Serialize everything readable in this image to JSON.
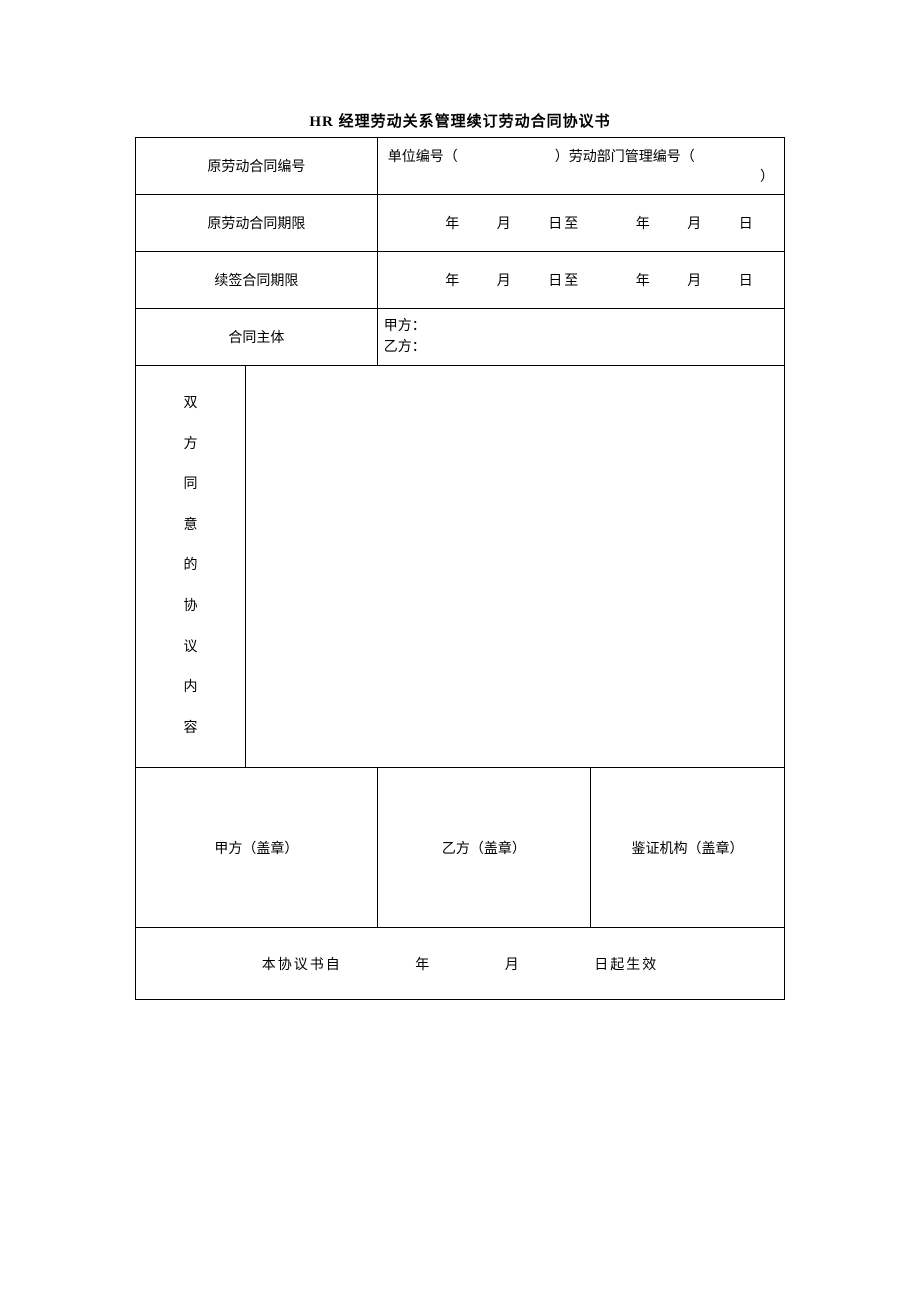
{
  "title": "HR 经理劳动关系管理续订劳动合同协议书",
  "rows": {
    "originalContractNo": {
      "label": "原劳动合同编号",
      "unitLabel": "单位编号（",
      "unitClose": "）劳动部门管理编号（",
      "endClose": "）"
    },
    "originalContractPeriod": {
      "label": "原劳动合同期限",
      "year1": "年",
      "month1": "月",
      "day1": "日至",
      "year2": "年",
      "month2": "月",
      "day2": "日"
    },
    "renewalPeriod": {
      "label": "续签合同期限",
      "year1": "年",
      "month1": "月",
      "day1": "日至",
      "year2": "年",
      "month2": "月",
      "day2": "日"
    },
    "contractParties": {
      "label": "合同主体",
      "partyA": "甲方：",
      "partyB": "乙方："
    },
    "agreementContent": {
      "labelVertical": "双方同意的协议内容"
    },
    "stamps": {
      "partyA": "甲方（盖章）",
      "partyB": "乙方（盖章）",
      "witness": "鉴证机构（盖章）"
    },
    "effective": {
      "prefix": "本协议书自",
      "year": "年",
      "month": "月",
      "suffix": "日起生效"
    }
  }
}
